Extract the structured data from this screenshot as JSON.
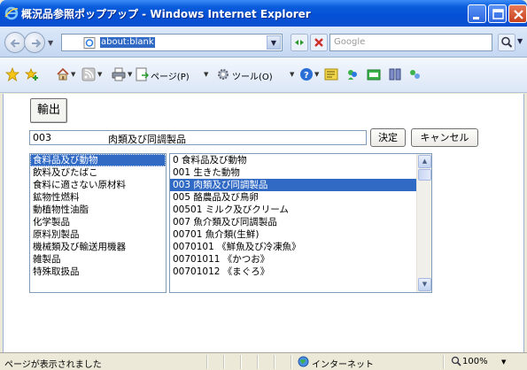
{
  "window": {
    "title": "概況品参照ポップアップ - Windows Internet Explorer"
  },
  "address_bar": {
    "url": "about:blank",
    "search_placeholder": "Google"
  },
  "command_bar": {
    "page_label": "ページ(P)",
    "tools_label": "ツール(O)"
  },
  "form": {
    "export_label": "輸出",
    "selected_code": "003",
    "selected_name": "肉類及び同調製品",
    "ok_label": "決定",
    "cancel_label": "キャンセル"
  },
  "categories": [
    "食料品及び動物",
    "飲料及びたばこ",
    "食料に適さない原材料",
    "鉱物性燃料",
    "動植物性油脂",
    "化学製品",
    "原料別製品",
    "機械類及び輸送用機器",
    "雑製品",
    "特殊取扱品"
  ],
  "selected_category_index": 0,
  "items": [
    "0  食料品及び動物",
    "001  生きた動物",
    "003  肉類及び同調製品",
    "005  酪農品及び鳥卵",
    "00501  ミルク及びクリーム",
    "007  魚介類及び同調製品",
    "00701  魚介類(生鮮)",
    "0070101 《鮮魚及び冷凍魚》",
    "00701011 《かつお》",
    "00701012 《まぐろ》"
  ],
  "selected_item_index": 2,
  "status_bar": {
    "message": "ページが表示されました",
    "zone": "インターネット",
    "zoom": "100%"
  },
  "colors": {
    "titlebar": "#0a5ddc",
    "selection": "#316ac5"
  }
}
